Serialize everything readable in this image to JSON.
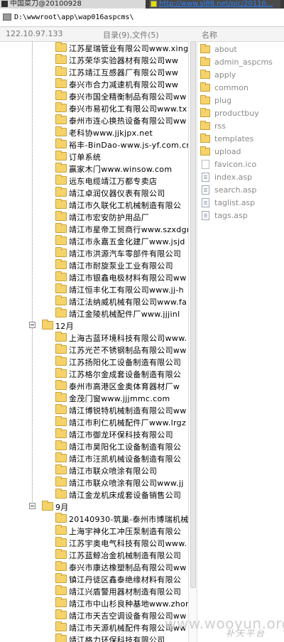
{
  "browser": {
    "tab1_title": "中国菜刀@20100928",
    "tab2_title": "http://www.sl88.net/pic/20110..."
  },
  "path": {
    "text": "D:\\wwwroot\\app\\wap016aspcms\\"
  },
  "header": {
    "ip": "122.10.97.133",
    "count": "目录(9),文件(5)",
    "name_col": "名称"
  },
  "tree": {
    "rows": [
      {
        "t": "child",
        "label": "江苏星瑞管业有限公司www.xing"
      },
      {
        "t": "child",
        "label": "江苏荣华实验器材有限公司ww"
      },
      {
        "t": "child",
        "label": "江苏靖江互感器厂有限公司ww"
      },
      {
        "t": "child",
        "label": "泰兴市合力减速机有限公司ww"
      },
      {
        "t": "child",
        "label": "泰兴市国全精衡制品有限公司ww"
      },
      {
        "t": "child",
        "label": "泰兴市易初化工有限公司www.tx"
      },
      {
        "t": "child",
        "label": "泰州市连心换热设备有限公司ww"
      },
      {
        "t": "child",
        "label": "老科协www.jjkjpx.net"
      },
      {
        "t": "child",
        "label": "裕丰-BinDao-www.js-yf.com.cn"
      },
      {
        "t": "child",
        "label": "订单系统"
      },
      {
        "t": "child",
        "label": "赢家木门www.winsow.com"
      },
      {
        "t": "child",
        "label": "远东电缆靖江万都专卖店"
      },
      {
        "t": "child",
        "label": "靖江卓润仪器仪表有限公司"
      },
      {
        "t": "child",
        "label": "靖江市久联化工机械制造有限公"
      },
      {
        "t": "child",
        "label": "靖江市宏安防护用品厂"
      },
      {
        "t": "child",
        "label": "靖江市星帝工贸商行www.szxdgm"
      },
      {
        "t": "child",
        "label": "靖江市永嘉五金化建厂www.jsjd"
      },
      {
        "t": "child",
        "label": "靖江市洪源汽车零部件有限公司"
      },
      {
        "t": "child",
        "label": "靖江市耐旋泵业工业有限公司"
      },
      {
        "t": "child",
        "label": "靖江市银鑫电极材料有限公司ww"
      },
      {
        "t": "child",
        "label": "靖江恒丰化工有限公司www.jj-h"
      },
      {
        "t": "child",
        "label": "靖江法纳威机械有限公司www.fa"
      },
      {
        "t": "child",
        "label": "靖江金陵机械配件厂www.jjjinl"
      },
      {
        "t": "group",
        "label": "12月"
      },
      {
        "t": "child",
        "label": "上海古蓝环境科技有限公司www."
      },
      {
        "t": "child",
        "label": "江苏光芒不锈钢制品有限公司ww"
      },
      {
        "t": "child",
        "label": "江苏扬阳化工设备制造有限公司"
      },
      {
        "t": "child",
        "label": "江苏格尔金成套设备制造有限公"
      },
      {
        "t": "child",
        "label": "泰州市高港区金奥体育器材厂w"
      },
      {
        "t": "child",
        "label": "金茂门窗www.jjjmmc.com"
      },
      {
        "t": "child",
        "label": "靖江博锐特机械制造有限公司ww"
      },
      {
        "t": "child",
        "label": "靖江市利仁机械配件厂www.lrgz"
      },
      {
        "t": "child",
        "label": "靖江市御龙环保科技有限公司"
      },
      {
        "t": "child",
        "label": "靖江市昊阳化工设备制造有限公"
      },
      {
        "t": "child",
        "label": "靖江市汪凯机械设备制造有限公"
      },
      {
        "t": "child",
        "label": "靖江市联众喷涂有限公司"
      },
      {
        "t": "child",
        "label": "靖江市联众喷涂有限公司www.jj"
      },
      {
        "t": "child",
        "label": "靖江金龙机床成套设备销售公司"
      },
      {
        "t": "group",
        "label": "9月"
      },
      {
        "t": "child",
        "label": "20140930-筑巢-泰州市博瑞机械"
      },
      {
        "t": "child",
        "label": "上海宇神化工冲压泵制造有限公"
      },
      {
        "t": "child",
        "label": "江苏宇奥电气科技有限公司www."
      },
      {
        "t": "child",
        "label": "江苏蓝鲸冶金机械制造有限公司"
      },
      {
        "t": "child",
        "label": "泰兴市康达橡塑制品有限公司ww"
      },
      {
        "t": "child",
        "label": "镇江丹徒区鑫泰绝缘材料有限公"
      },
      {
        "t": "child",
        "label": "靖江兴盾警用器材制造有限公司"
      },
      {
        "t": "child",
        "label": "靖江市中山杉良种基地www.zhon"
      },
      {
        "t": "child",
        "label": "靖江市天吉空调设备有限公司ww"
      },
      {
        "t": "child",
        "label": "靖江市天源机械配件有限公司ww"
      },
      {
        "t": "child",
        "label": "靖江格力环保科技有限公司"
      }
    ]
  },
  "files": {
    "items": [
      {
        "kind": "folder",
        "name": "about"
      },
      {
        "kind": "folder",
        "name": "admin_aspcms"
      },
      {
        "kind": "folder",
        "name": "apply"
      },
      {
        "kind": "folder",
        "name": "common"
      },
      {
        "kind": "folder",
        "name": "plug"
      },
      {
        "kind": "folder",
        "name": "productbuy"
      },
      {
        "kind": "folder",
        "name": "rss"
      },
      {
        "kind": "folder",
        "name": "templates"
      },
      {
        "kind": "folder",
        "name": "upload"
      },
      {
        "kind": "ico",
        "name": "favicon.ico"
      },
      {
        "kind": "file",
        "name": "index.asp"
      },
      {
        "kind": "file",
        "name": "search.asp"
      },
      {
        "kind": "file",
        "name": "taglist.asp"
      },
      {
        "kind": "file",
        "name": "tags.asp"
      }
    ]
  },
  "watermark": {
    "site": "www.wooyun.org",
    "slogan": "补天平台"
  }
}
